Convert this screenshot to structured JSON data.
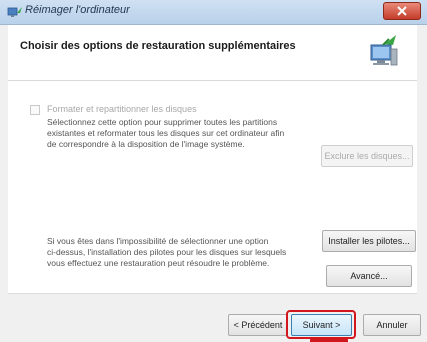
{
  "window": {
    "title": "Réimager l'ordinateur",
    "header_title": "Choisir des options de restauration supplémentaires"
  },
  "format_option": {
    "checkbox_label": "Formater et repartitionner les disques",
    "checked": false,
    "enabled": false,
    "description": [
      "Sélectionnez cette option pour supprimer toutes les partitions",
      "existantes et reformater tous les disques sur cet ordinateur afin",
      "de correspondre à la disposition de l'image système."
    ],
    "exclude_button": "Exclure les disques..."
  },
  "driver_option": {
    "description": [
      "Si vous êtes dans l'impossibilité de sélectionner une option",
      "ci-dessus, l'installation des pilotes pour les disques sur lesquels",
      "vous effectuez une restauration peut résoudre le problème."
    ],
    "install_button": "Installer les pilotes...",
    "advanced_button": "Avancé..."
  },
  "footer": {
    "previous_button": "< Précédent",
    "next_button": "Suivant >",
    "cancel_button": "Annuler"
  },
  "colors": {
    "highlight": "#d2161e",
    "title_bar": "#b9d1ea"
  }
}
